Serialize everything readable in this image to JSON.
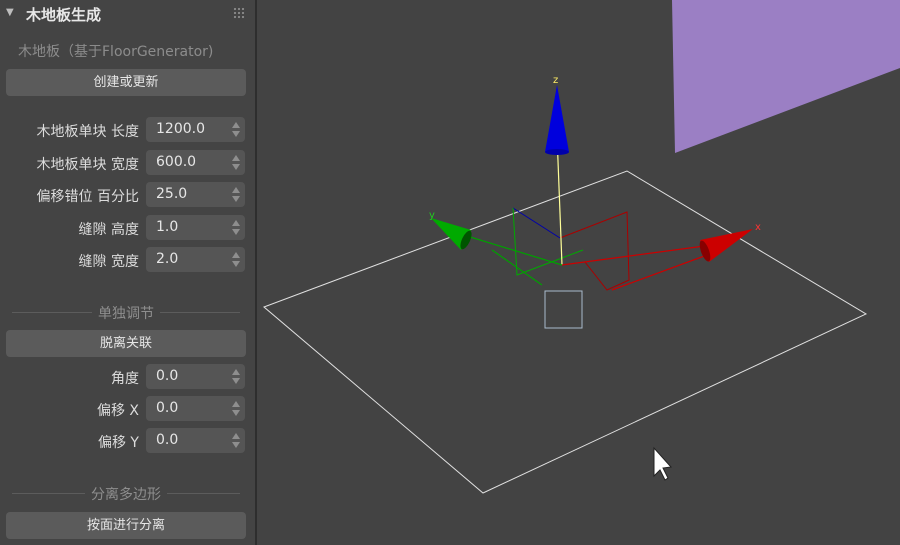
{
  "panel": {
    "title": "木地板生成",
    "subtitle": "木地板（基于FloorGenerator)",
    "create_button": "创建或更新",
    "rows": [
      {
        "label": "木地板单块 长度",
        "value": "1200.0"
      },
      {
        "label": "木地板单块 宽度",
        "value": "600.0"
      },
      {
        "label": "偏移错位 百分比",
        "value": "25.0"
      },
      {
        "label": "缝隙 高度",
        "value": "1.0"
      },
      {
        "label": "缝隙 宽度",
        "value": "2.0"
      }
    ],
    "section_individual": "单独调节",
    "detach_button": "脱离关联",
    "adjust_rows": [
      {
        "label": "角度",
        "value": "0.0"
      },
      {
        "label": "偏移 X",
        "value": "0.0"
      },
      {
        "label": "偏移 Y",
        "value": "0.0"
      }
    ],
    "section_separate": "分离多边形",
    "separate_button": "按面进行分离"
  },
  "viewport": {
    "axis_labels": {
      "x": "x",
      "y": "y",
      "z": "z"
    },
    "colors": {
      "x_axis": "#cc0000",
      "y_axis": "#00a000",
      "z_axis": "#0000cc",
      "purple_plane": "#9b7fc4",
      "plane_outline": "#e0e0e0"
    }
  }
}
